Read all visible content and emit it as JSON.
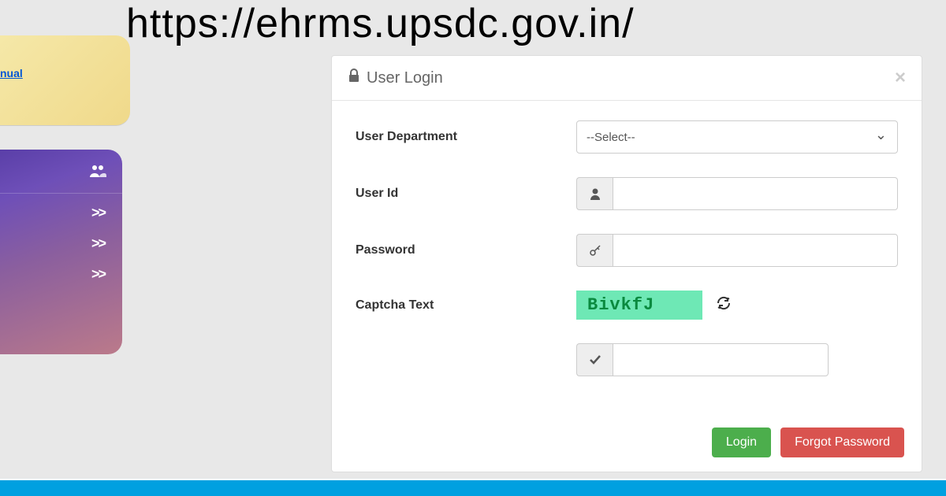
{
  "header": {
    "url": "https://ehrms.upsdc.gov.in/"
  },
  "sidebar": {
    "yellow": {
      "link_text": "nual"
    },
    "purple": {
      "chevrons": [
        ">>",
        ">>",
        ">>"
      ]
    }
  },
  "modal": {
    "title": "User Login",
    "labels": {
      "department": "User Department",
      "userid": "User Id",
      "password": "Password",
      "captcha": "Captcha Text"
    },
    "department_select": {
      "placeholder": "--Select--"
    },
    "userid_value": "",
    "password_value": "",
    "captcha_image_text": "BivkfJ",
    "captcha_input_value": "",
    "buttons": {
      "login": "Login",
      "forgot": "Forgot Password"
    }
  }
}
